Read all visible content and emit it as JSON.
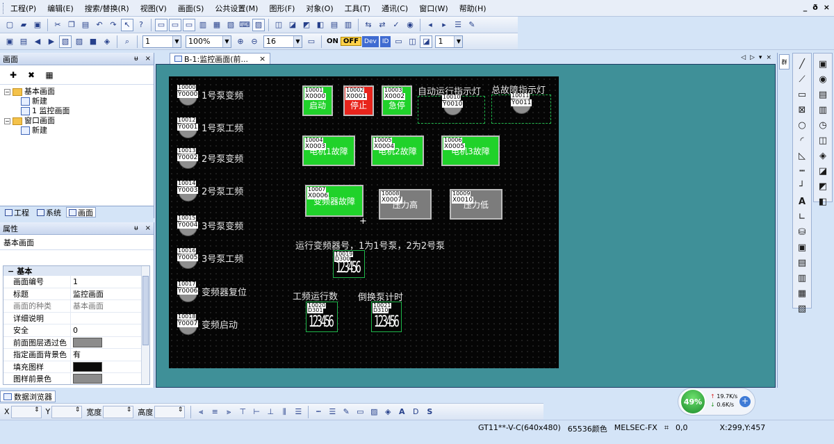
{
  "menu": [
    "工程(P)",
    "编辑(E)",
    "搜索/替换(R)",
    "视图(V)",
    "画面(S)",
    "公共设置(M)",
    "图形(F)",
    "对象(O)",
    "工具(T)",
    "通讯(C)",
    "窗口(W)",
    "帮助(H)"
  ],
  "window_controls": [
    "_",
    "ð",
    "×"
  ],
  "toolbar": {
    "combo_1": "1",
    "zoom": "100%",
    "grid": "16",
    "combo_2": "1",
    "on_label": "ON",
    "off_label": "OFF",
    "dev_label": "Dev",
    "id_label": "ID"
  },
  "screen_pane": {
    "title": "画面",
    "pin": "ᵾ",
    "close": "×",
    "tree": {
      "base_screens": "基本画面",
      "base_new": "新建",
      "monitor_screen": "1  监控画面",
      "window_screens": "窗口画面",
      "window_new": "新建"
    },
    "tabs": [
      "工程",
      "系统",
      "画面"
    ]
  },
  "prop_pane": {
    "title": "属性",
    "pin": "ᵾ",
    "close": "×",
    "subject": "基本画面",
    "group": "基本",
    "rows": [
      {
        "k": "画面编号",
        "v": "1"
      },
      {
        "k": "标题",
        "v": "监控画面"
      },
      {
        "k": "画面的种类",
        "v": "基本画面"
      },
      {
        "k": "详细说明",
        "v": ""
      },
      {
        "k": "安全",
        "v": "0"
      },
      {
        "k": "前面图层透过色",
        "v": ""
      },
      {
        "k": "指定画面背景色",
        "v": "有"
      },
      {
        "k": "填充图样",
        "v": ""
      },
      {
        "k": "图样前景色",
        "v": ""
      }
    ],
    "swatch_colors": {
      "front_layer": "#8c8c8c",
      "fill_pattern": "#0a0a0a",
      "pattern_fg": "#8c8c8c"
    }
  },
  "doc": {
    "tab_label": "B-1:监控画面(前...",
    "tab_close": "×",
    "controls": [
      "◁",
      "▷",
      "▾",
      "×"
    ]
  },
  "canvas": {
    "lamps": [
      {
        "tag1": "10000",
        "tag2": "Y0000",
        "label": "1号泵变频"
      },
      {
        "tag1": "10012",
        "tag2": "Y0001",
        "label": "1号泵工频"
      },
      {
        "tag1": "10013",
        "tag2": "Y0002",
        "label": "2号泵变频"
      },
      {
        "tag1": "10014",
        "tag2": "Y0003",
        "label": "2号泵工频"
      },
      {
        "tag1": "10015",
        "tag2": "Y0004",
        "label": "3号泵变频"
      },
      {
        "tag1": "10016",
        "tag2": "Y0005",
        "label": "3号泵工频"
      },
      {
        "tag1": "10017",
        "tag2": "Y0006",
        "label": "变频器复位"
      },
      {
        "tag1": "10018",
        "tag2": "Y0007",
        "label": "变频启动"
      }
    ],
    "buttons": {
      "start": {
        "tag1": "10001",
        "tag2": "X0000",
        "label": "启动"
      },
      "stop": {
        "tag1": "10002",
        "tag2": "X0001",
        "label": "停止"
      },
      "estop": {
        "tag1": "10003",
        "tag2": "X0002",
        "label": "急停"
      },
      "fault1": {
        "tag1": "10004",
        "tag2": "X0003",
        "label": "电机1故障"
      },
      "fault2": {
        "tag1": "10005",
        "tag2": "X0004",
        "label": "电机2故障"
      },
      "fault3": {
        "tag1": "10006",
        "tag2": "X0005",
        "label": "电机3故障"
      },
      "vfd_fault": {
        "tag1": "10007",
        "tag2": "X0006",
        "label": "变频器故障"
      },
      "high_press": {
        "tag1": "10008",
        "tag2": "X0007",
        "label": "压力高"
      },
      "low_press": {
        "tag1": "10009",
        "tag2": "X0010",
        "label": "压力低"
      }
    },
    "auto_lamp": {
      "title": "自动运行指示灯",
      "tag1": "10010",
      "tag2": "Y0010"
    },
    "fault_lamp": {
      "title": "总故障指示灯",
      "tag1": "10011",
      "tag2": "Y0011"
    },
    "vfd_text": "运行变频器号，1为1号泵，2为2号泵",
    "vfd_num": {
      "tag1": "10019",
      "tag2": "D300",
      "digits": "123456"
    },
    "power_label": "工频运行数",
    "power_num": {
      "tag1": "10020",
      "tag2": "D301",
      "digits": "123456"
    },
    "switch_label": "倒换泵计时",
    "switch_num": {
      "tag1": "10021",
      "tag2": "D310",
      "digits": "123456"
    }
  },
  "colors": {
    "canvas_bg": "#050505",
    "workspace": "#3f9098",
    "btn_green": "#20d22a",
    "btn_red": "#e8241c",
    "btn_gray": "#7c7c7c"
  },
  "right_strip": {
    "tag": "群"
  },
  "bottom": {
    "data_tab": "数据浏览器",
    "x_label": "X",
    "y_label": "Y",
    "w_label": "宽度",
    "h_label": "高度"
  },
  "status": {
    "device": "GT11**-V-C(640x480)",
    "colors": "65536颜色",
    "plc": "MELSEC-FX",
    "pos": "0,0",
    "cursor": "X:299,Y:457"
  },
  "net": {
    "percent": "49%",
    "up": "19.7K/s",
    "down": "0.6K/s"
  }
}
